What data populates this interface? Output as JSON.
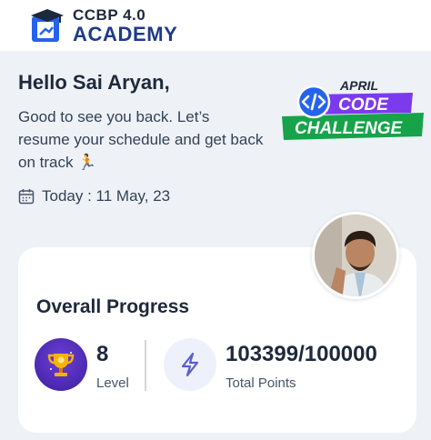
{
  "header": {
    "logo_line1": "CCBP 4.0",
    "logo_line2": "ACADEMY"
  },
  "greeting": "Hello Sai Aryan,",
  "subtitle": "Good to see you back. Let’s resume your schedule and get back on track 🏃",
  "date": {
    "icon": "calendar-icon",
    "text": "Today : 11 May, 23"
  },
  "challenge_badge": {
    "month": "APRIL",
    "word1": "CODE",
    "word2": "CHALLENGE",
    "colors": {
      "purple": "#7c3aed",
      "green": "#16a34a"
    }
  },
  "progress_card": {
    "title": "Overall Progress",
    "level": {
      "value": "8",
      "label": "Level",
      "icon": "trophy-icon"
    },
    "points": {
      "value": "103399/100000",
      "label": "Total Points",
      "icon": "lightning-icon"
    }
  },
  "colors": {
    "accent": "#1e3a8a",
    "background": "#eef2f7",
    "card": "#ffffff"
  }
}
